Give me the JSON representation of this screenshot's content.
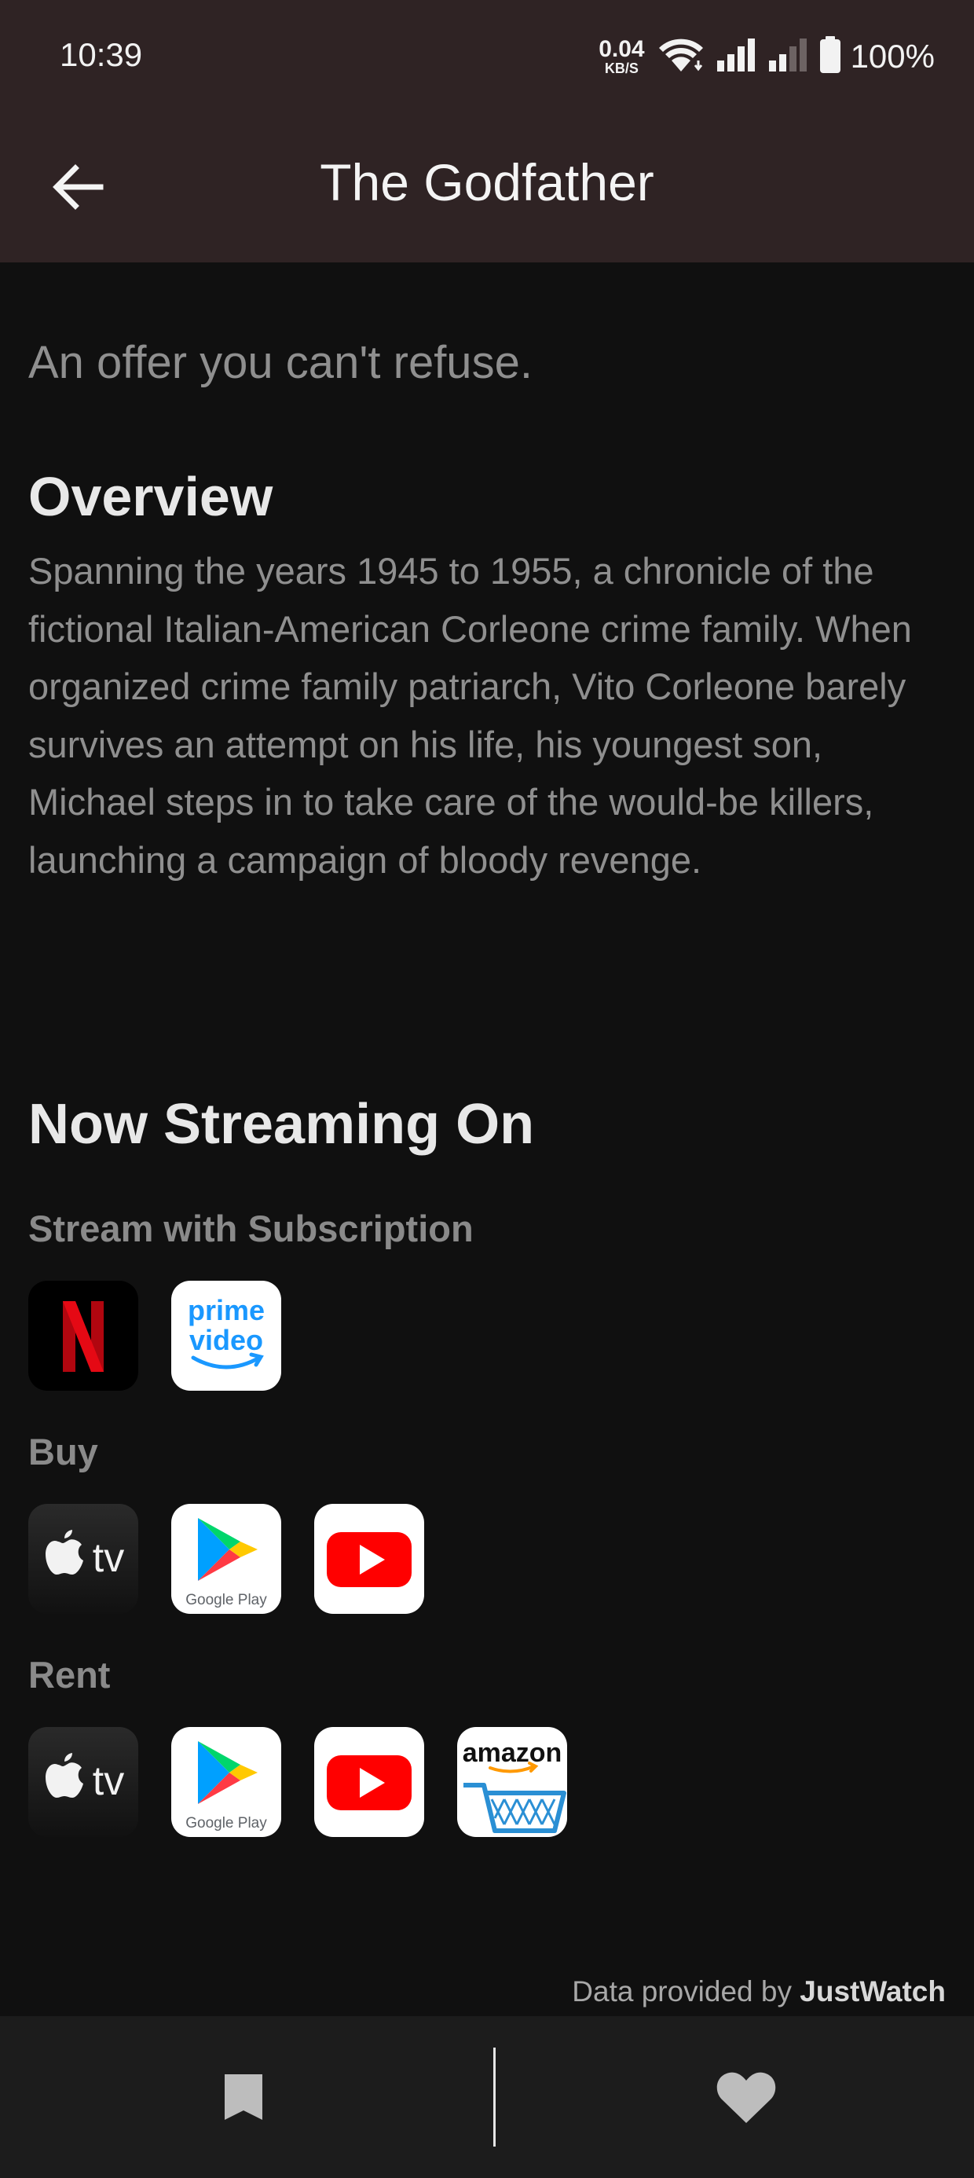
{
  "status_bar": {
    "time": "10:39",
    "net_speed_value": "0.04",
    "net_speed_unit": "KB/S",
    "battery": "100%"
  },
  "app_bar": {
    "title": "The Godfather",
    "back_icon": "arrow-left-icon"
  },
  "movie": {
    "tagline": "An offer you can't refuse.",
    "overview_heading": "Overview",
    "overview": "Spanning the years 1945 to 1955, a chronicle of the fictional Italian-American Corleone crime family. When organized crime family patriarch, Vito Corleone barely survives an attempt on his life, his youngest son, Michael steps in to take care of the would-be killers, launching a campaign of bloody revenge."
  },
  "streaming": {
    "heading": "Now Streaming On",
    "subscription_label": "Stream with Subscription",
    "buy_label": "Buy",
    "rent_label": "Rent",
    "subscription": [
      "netflix",
      "prime-video"
    ],
    "buy": [
      "apple-tv",
      "google-play",
      "youtube"
    ],
    "rent": [
      "apple-tv",
      "google-play",
      "youtube",
      "amazon"
    ]
  },
  "provider_text": {
    "prime": "prime",
    "video": "video",
    "tv": "tv",
    "google_play": "Google Play",
    "amazon": "amazon"
  },
  "attribution": {
    "prefix": "Data provided by ",
    "brand": "JustWatch"
  },
  "bottom_nav": {
    "left_icon": "bookmark-icon",
    "right_icon": "heart-icon"
  },
  "colors": {
    "app_bar": "#2f2324",
    "background": "#101010",
    "netflix_red": "#e50914",
    "prime_blue": "#1a98ff",
    "youtube_red": "#ff0000"
  }
}
